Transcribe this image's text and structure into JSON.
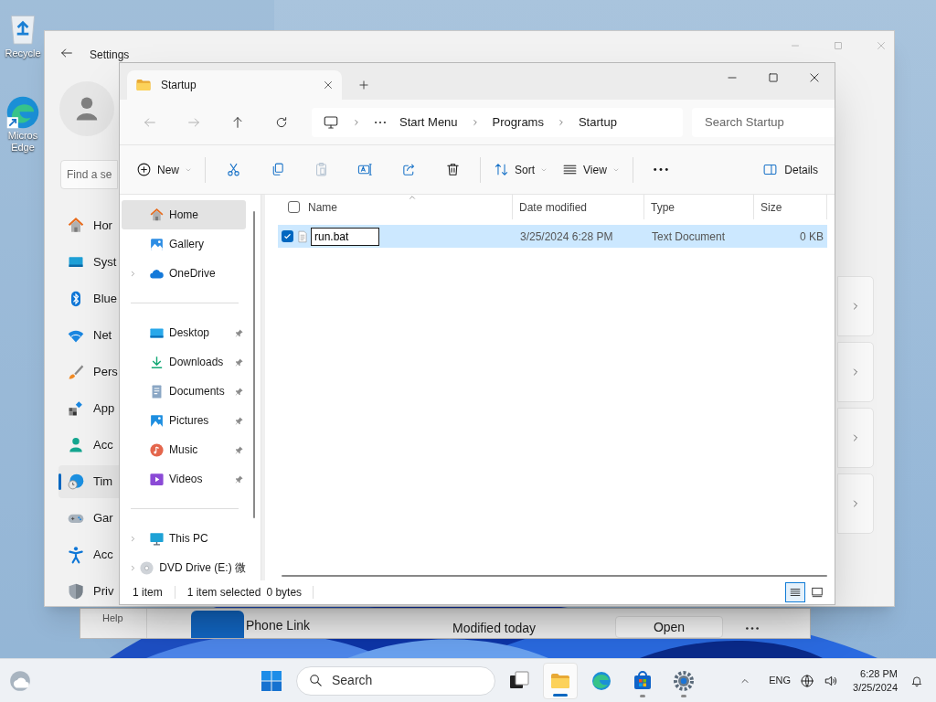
{
  "desktop_icons": [
    {
      "kind": "recycle",
      "lines": [
        "Recycle"
      ]
    },
    {
      "kind": "edge",
      "lines": [
        "Micros",
        "Edge"
      ]
    }
  ],
  "background_window": {
    "help": "Help",
    "app_name": "Phone Link",
    "modified": "Modified today",
    "open_button": "Open"
  },
  "settings": {
    "title": "Settings",
    "search_placeholder": "Find a se",
    "nav": [
      {
        "kind": "home",
        "label": "Hor",
        "selected": false
      },
      {
        "kind": "system",
        "label": "Syst",
        "selected": false
      },
      {
        "kind": "bluetooth",
        "label": "Blue",
        "selected": false
      },
      {
        "kind": "network",
        "label": "Net",
        "selected": false
      },
      {
        "kind": "personalization",
        "label": "Pers",
        "selected": false
      },
      {
        "kind": "apps",
        "label": "App",
        "selected": false
      },
      {
        "kind": "accounts",
        "label": "Acc",
        "selected": false
      },
      {
        "kind": "time",
        "label": "Tim",
        "selected": true
      },
      {
        "kind": "gaming",
        "label": "Gar",
        "selected": false
      },
      {
        "kind": "accessibility",
        "label": "Acc",
        "selected": false
      },
      {
        "kind": "privacy",
        "label": "Priv",
        "selected": false
      }
    ]
  },
  "explorer": {
    "tab": {
      "title": "Startup"
    },
    "breadcrumb": [
      "Start Menu",
      "Programs",
      "Startup"
    ],
    "search_placeholder": "Search Startup",
    "toolbar": [
      {
        "kind": "new",
        "label": "New",
        "disabled": false
      },
      {
        "kind": "cut",
        "disabled": false
      },
      {
        "kind": "copy",
        "disabled": false
      },
      {
        "kind": "paste",
        "disabled": true
      },
      {
        "kind": "rename",
        "disabled": false
      },
      {
        "kind": "share",
        "disabled": false
      },
      {
        "kind": "delete",
        "disabled": false
      },
      {
        "kind": "sort",
        "label": "Sort",
        "disabled": false
      },
      {
        "kind": "view",
        "label": "View",
        "disabled": false
      },
      {
        "kind": "more",
        "disabled": false
      }
    ],
    "details_button": "Details",
    "sidebar_groups": [
      {
        "items": [
          {
            "kind": "home",
            "label": "Home",
            "selected": true,
            "pinned": false,
            "expandable": false
          },
          {
            "kind": "gallery",
            "label": "Gallery",
            "selected": false,
            "pinned": false,
            "expandable": false
          },
          {
            "kind": "onedrive",
            "label": "OneDrive",
            "selected": false,
            "pinned": false,
            "expandable": true
          }
        ]
      },
      {
        "items": [
          {
            "kind": "desktop",
            "label": "Desktop",
            "selected": false,
            "pinned": true,
            "expandable": false
          },
          {
            "kind": "downloads",
            "label": "Downloads",
            "selected": false,
            "pinned": true,
            "expandable": false
          },
          {
            "kind": "documents",
            "label": "Documents",
            "selected": false,
            "pinned": true,
            "expandable": false
          },
          {
            "kind": "pictures",
            "label": "Pictures",
            "selected": false,
            "pinned": true,
            "expandable": false
          },
          {
            "kind": "music",
            "label": "Music",
            "selected": false,
            "pinned": true,
            "expandable": false
          },
          {
            "kind": "videos",
            "label": "Videos",
            "selected": false,
            "pinned": true,
            "expandable": false
          }
        ]
      },
      {
        "items": [
          {
            "kind": "thispc",
            "label": "This PC",
            "selected": false,
            "pinned": false,
            "expandable": true
          },
          {
            "kind": "dvd",
            "label": "DVD Drive (E:) 微",
            "selected": false,
            "pinned": false,
            "expandable": true
          }
        ]
      }
    ],
    "select_all_checked": false,
    "columns": [
      "Name",
      "Date modified",
      "Type",
      "Size"
    ],
    "rows": [
      {
        "name": "run.bat",
        "date_modified": "3/25/2024 6:28 PM",
        "type": "Text Document",
        "size": "0 KB",
        "selected": true,
        "checked": true,
        "renaming": true
      }
    ],
    "status": {
      "count": "1 item",
      "selection": "1 item selected",
      "size": "0 bytes",
      "view_buttons": [
        {
          "kind": "details",
          "selected": true
        },
        {
          "kind": "tiles",
          "selected": false
        }
      ]
    }
  },
  "taskbar": {
    "search_placeholder": "Search",
    "apps": [
      {
        "kind": "taskview",
        "active": false,
        "running": false
      },
      {
        "kind": "explorer",
        "active": true,
        "running": true
      },
      {
        "kind": "edge",
        "active": false,
        "running": false
      },
      {
        "kind": "store",
        "active": false,
        "running": true
      },
      {
        "kind": "settings",
        "active": false,
        "running": true
      }
    ],
    "language": "ENG",
    "time": "6:28 PM",
    "date": "3/25/2024"
  }
}
